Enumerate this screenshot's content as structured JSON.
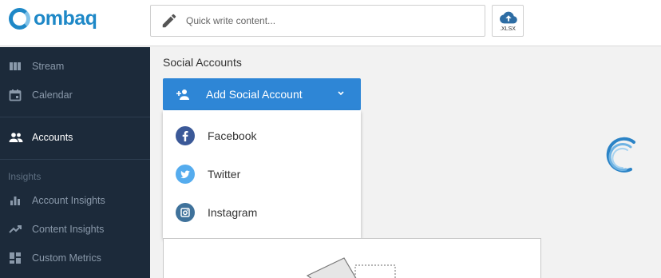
{
  "brand": {
    "name": "ombaq",
    "color": "#1e88c7"
  },
  "header": {
    "quick_write_placeholder": "Quick write content...",
    "export_label": ".XLSX"
  },
  "sidebar": {
    "items": [
      {
        "label": "Stream",
        "icon": "stream-columns-icon"
      },
      {
        "label": "Calendar",
        "icon": "calendar-icon"
      },
      {
        "label": "Accounts",
        "icon": "people-icon",
        "active": true
      }
    ],
    "insights_heading": "Insights",
    "insights_items": [
      {
        "label": "Account Insights",
        "icon": "bar-chart-icon"
      },
      {
        "label": "Content Insights",
        "icon": "trending-up-icon"
      },
      {
        "label": "Custom Metrics",
        "icon": "dashboard-icon"
      }
    ]
  },
  "main": {
    "title": "Social Accounts",
    "add_button_label": "Add Social Account",
    "dropdown": [
      {
        "label": "Facebook",
        "icon": "facebook-icon",
        "color": "#3b5998"
      },
      {
        "label": "Twitter",
        "icon": "twitter-icon",
        "color": "#55acee"
      },
      {
        "label": "Instagram",
        "icon": "instagram-icon",
        "color": "#3f729b"
      }
    ]
  },
  "colors": {
    "primary": "#2e86d6",
    "sidebar_bg": "#1c2a3a",
    "sidebar_text": "#8a99aa"
  }
}
